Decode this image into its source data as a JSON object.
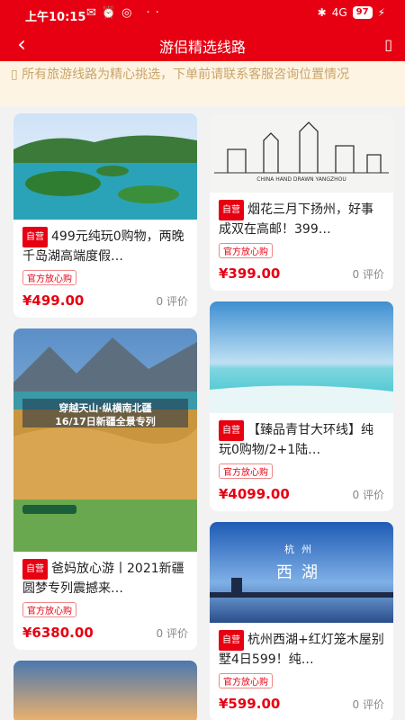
{
  "status": {
    "time": "上午10:15",
    "signal": "4G",
    "battery": "97"
  },
  "header": {
    "title": "游侣精选线路",
    "back_icon": "‹"
  },
  "notice": {
    "text": "所有旅游线路为精心挑选，下单前请联系客服咨询位置情况"
  },
  "cards_left": [
    {
      "title": "499元纯玩0购物，两晚千岛湖高端度假…",
      "badge": "自营",
      "tag": "官方放心购",
      "price": "¥499.00",
      "reviews": "0 评价",
      "image_desc": "lake-islands"
    },
    {
      "title": "爸妈放心游丨2021新疆圆梦专列震撼来…",
      "badge": "自营",
      "tag": "官方放心购",
      "price": "¥6380.00",
      "reviews": "0 评价",
      "image_desc": "xinjiang-poster",
      "poster_line1": "穿越天山·纵横南北疆",
      "poster_line2": "16/17日新疆全景专列"
    },
    {
      "title": "",
      "badge": "",
      "tag": "",
      "price": "",
      "reviews": "",
      "image_desc": "sunset-sky"
    }
  ],
  "cards_right": [
    {
      "title": "烟花三月下扬州，好事成双在高邮！399…",
      "badge": "自营",
      "tag": "官方放心购",
      "price": "¥399.00",
      "reviews": "0 评价",
      "image_desc": "yangzhou-sketch",
      "image_caption": "CHINA HAND DRAWN YANGZHOU"
    },
    {
      "title": "【臻品青甘大环线】纯玩0购物/2+1陆…",
      "badge": "自营",
      "tag": "官方放心购",
      "price": "¥4099.00",
      "reviews": "0 评价",
      "image_desc": "salt-lake"
    },
    {
      "title": "杭州西湖+红灯笼木屋别墅4日599！纯…",
      "badge": "自营",
      "tag": "官方放心购",
      "price": "¥599.00",
      "reviews": "0 评价",
      "image_desc": "west-lake",
      "image_text1": "杭州",
      "image_text2": "西湖"
    }
  ]
}
